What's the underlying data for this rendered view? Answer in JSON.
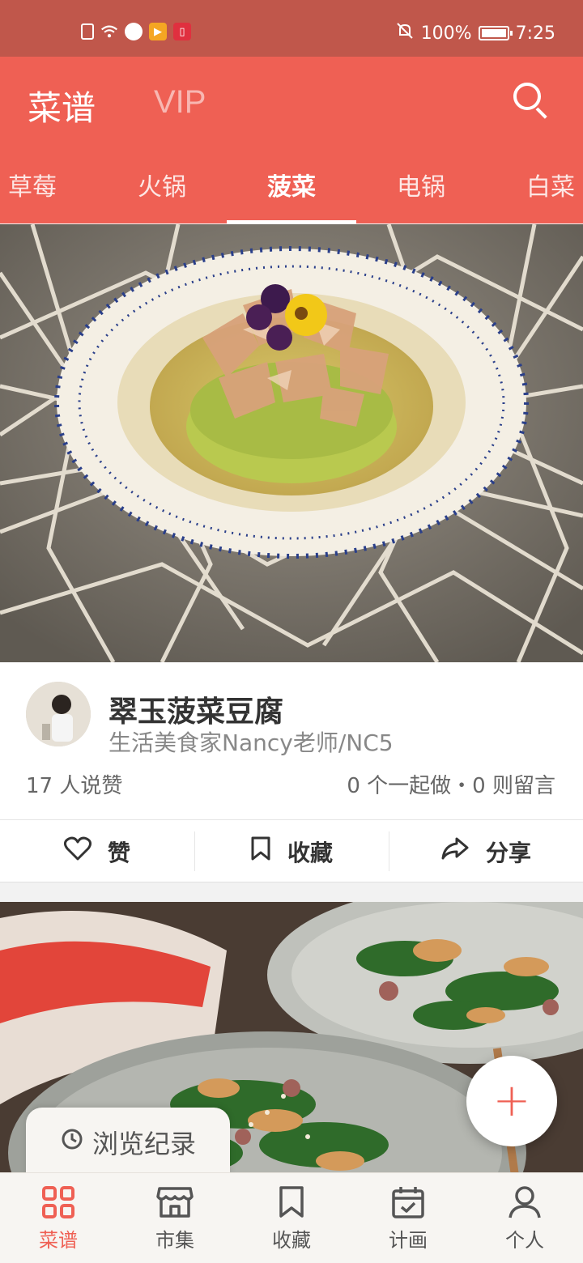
{
  "status_bar": {
    "battery": "100%",
    "time": "7:25"
  },
  "header": {
    "title": "菜谱",
    "vip": "VIP"
  },
  "tabs": [
    {
      "label": "草莓"
    },
    {
      "label": "火锅"
    },
    {
      "label": "菠菜",
      "active": true
    },
    {
      "label": "电锅"
    },
    {
      "label": "白菜"
    }
  ],
  "recipe": {
    "title": "翠玉菠菜豆腐",
    "author": "生活美食家Nancy老师/NC5",
    "likes_text": "17 人说赞",
    "stats_text": "0 个一起做・0 则留言"
  },
  "actions": {
    "like": "赞",
    "collect": "收藏",
    "share": "分享"
  },
  "fab": {
    "icon": "plus-icon"
  },
  "history": {
    "label": "浏览纪录"
  },
  "nav": [
    {
      "label": "菜谱",
      "icon": "grid-icon",
      "active": true
    },
    {
      "label": "市集",
      "icon": "store-icon"
    },
    {
      "label": "收藏",
      "icon": "bookmark-icon"
    },
    {
      "label": "计画",
      "icon": "calendar-icon"
    },
    {
      "label": "个人",
      "icon": "person-icon"
    }
  ],
  "colors": {
    "brand": "#ef6054",
    "statusbar": "#c0574b"
  }
}
